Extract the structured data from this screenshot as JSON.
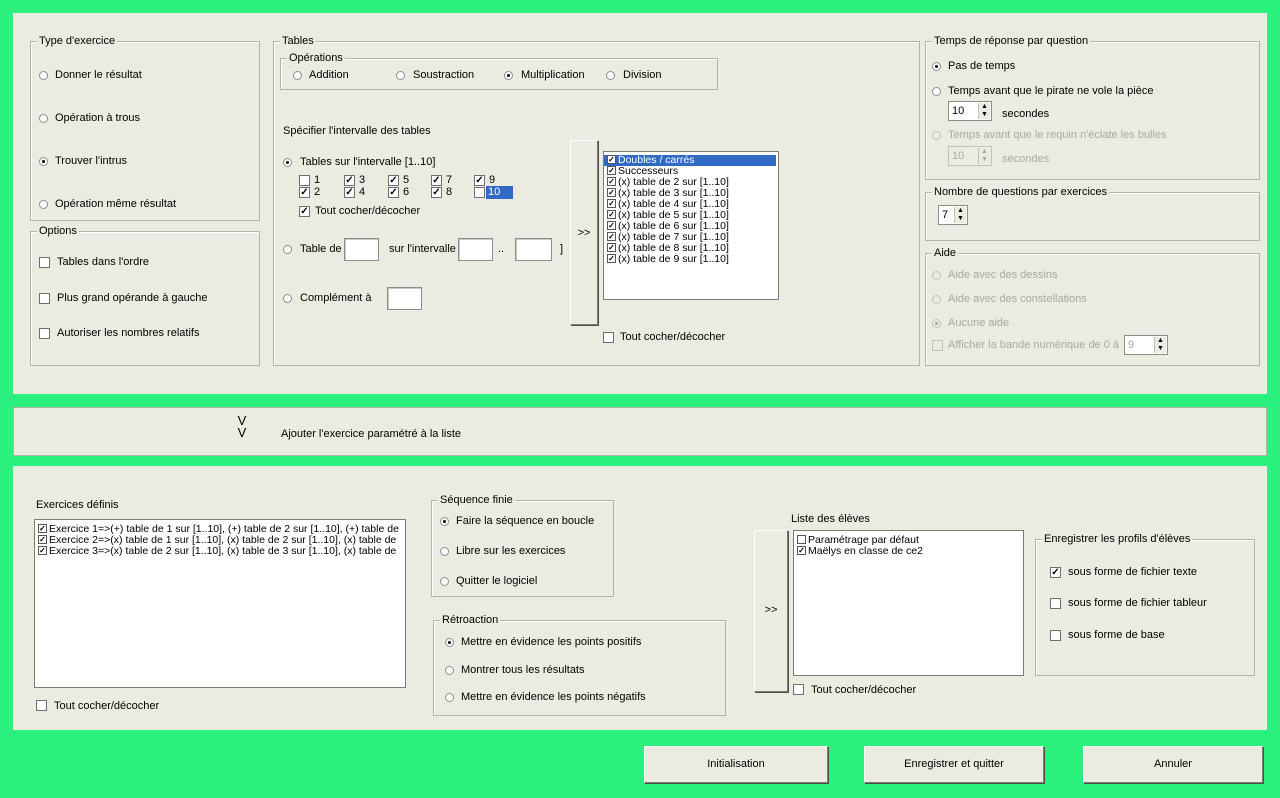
{
  "type_exercice": {
    "title": "Type d'exercice",
    "options": [
      "Donner le résultat",
      "Opération à trous",
      "Trouver l'intrus",
      "Opération même résultat"
    ]
  },
  "options": {
    "title": "Options",
    "items": [
      "Tables dans l'ordre",
      "Plus grand opérande à gauche",
      "Autoriser les nombres relatifs"
    ]
  },
  "tables": {
    "title": "Tables",
    "operations_title": "Opérations",
    "operations": [
      "Addition",
      "Soustraction",
      "Multiplication",
      "Division"
    ],
    "interval_heading": "Spécifier l'intervalle des tables",
    "interval_radio": "Tables sur l'intervalle [1..10]",
    "numbers": [
      "1",
      "2",
      "3",
      "4",
      "5",
      "6",
      "7",
      "8",
      "9",
      "10"
    ],
    "toggle_all": "Tout cocher/décocher",
    "table_de": "Table de",
    "sur_intervalle": "sur l'intervalle [",
    "range_sep": "..",
    "range_close": "]",
    "complement": "Complément à",
    "arrow": ">>",
    "list": [
      "Doubles / carrés",
      "Successeurs",
      "(x) table de 2 sur [1..10]",
      "(x) table de 3 sur [1..10]",
      "(x) table de 4 sur [1..10]",
      "(x) table de 5 sur [1..10]",
      "(x) table de 6 sur [1..10]",
      "(x) table de 7 sur [1..10]",
      "(x) table de 8 sur [1..10]",
      "(x) table de 9 sur [1..10]"
    ],
    "list_toggle": "Tout cocher/décocher"
  },
  "temps": {
    "title": "Temps de réponse par question",
    "options": [
      "Pas de temps",
      "Temps avant que le pirate ne vole la pièce",
      "Temps avant que le requin n'éclate les bulles"
    ],
    "value1": "10",
    "value2": "10",
    "unit": "secondes"
  },
  "nombre": {
    "title": "Nombre de questions par exercices",
    "value": "7"
  },
  "aide": {
    "title": "Aide",
    "options": [
      "Aide avec des dessins",
      "Aide avec des constellations",
      "Aucune aide"
    ],
    "band_label": "Afficher la bande numérique de 0 à",
    "band_value": "9"
  },
  "add": {
    "icon": "double-chevron-down",
    "label": "Ajouter l'exercice paramétré à la liste"
  },
  "exercices": {
    "title": "Exercices définis",
    "items": [
      "Exercice 1=>(+) table de 1 sur [1..10], (+) table de 2 sur [1..10], (+) table de",
      "Exercice 2=>(x) table de 1 sur [1..10], (x) table de 2 sur [1..10], (x) table de",
      "Exercice 3=>(x) table de 2 sur [1..10], (x) table de 3 sur [1..10], (x) table de"
    ],
    "toggle": "Tout cocher/décocher"
  },
  "sequence": {
    "title": "Séquence finie",
    "options": [
      "Faire la séquence en boucle",
      "Libre sur les exercices",
      "Quitter le logiciel"
    ]
  },
  "retroaction": {
    "title": "Rétroaction",
    "options": [
      "Mettre en évidence les points positifs",
      "Montrer tous les résultats",
      "Mettre en évidence les points négatifs"
    ]
  },
  "eleves": {
    "title": "Liste des élèves",
    "arrow": ">>",
    "items": [
      "Paramétrage par défaut",
      "Maëlys en classe de ce2"
    ],
    "toggle": "Tout cocher/décocher"
  },
  "profils": {
    "title": "Enregistrer les profils d'élèves",
    "items": [
      "sous forme de fichier texte",
      "sous forme de fichier tableur",
      "sous forme de base"
    ]
  },
  "buttons": {
    "init": "Initialisation",
    "save": "Enregistrer et quitter",
    "cancel": "Annuler"
  },
  "colors": {
    "background": "#2cf07e",
    "panel": "#ecebe1",
    "selection": "#316ac5"
  }
}
